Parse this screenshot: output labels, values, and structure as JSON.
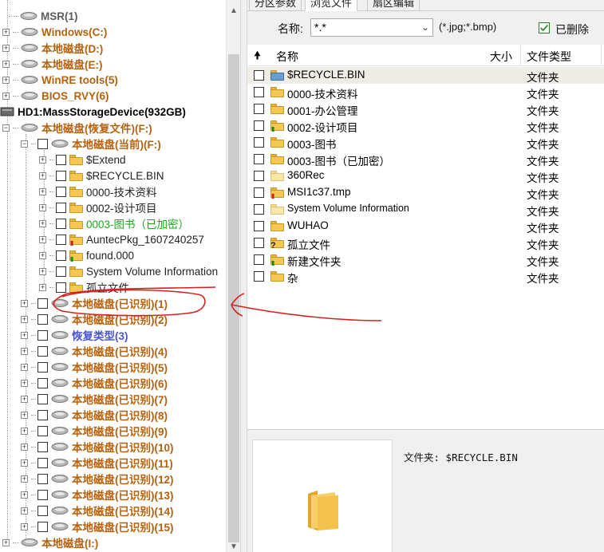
{
  "tabs": [
    "分区参数",
    "浏览文件",
    "扇区编辑"
  ],
  "filter": {
    "name_label": "名称:",
    "name_value": "*.*",
    "ext_hint": "(*.jpg;*.bmp)",
    "deleted_label": "已删除",
    "deleted_checked": true
  },
  "file_list": {
    "columns": [
      "名称",
      "大小",
      "文件类型"
    ],
    "rows": [
      {
        "name": "$RECYCLE.BIN",
        "type": "文件夹",
        "selected": true,
        "icon": "recycle-folder-icon"
      },
      {
        "name": "0000-技术资料",
        "type": "文件夹",
        "icon": "folder-icon"
      },
      {
        "name": "0001-办公管理",
        "type": "文件夹",
        "icon": "folder-icon"
      },
      {
        "name": "0002-设计项目",
        "type": "文件夹",
        "icon": "folder-icon"
      },
      {
        "name": "0003-图书",
        "type": "文件夹",
        "icon": "folder-icon"
      },
      {
        "name": "0003-图书（已加密）",
        "type": "文件夹",
        "icon": "folder-icon"
      },
      {
        "name": "360Rec",
        "type": "文件夹",
        "icon": "folder-icon"
      },
      {
        "name": "MSI1c37.tmp",
        "type": "文件夹",
        "icon": "deleted-folder-icon"
      },
      {
        "name": "System Volume Information",
        "type": "文件夹",
        "icon": "folder-icon"
      },
      {
        "name": "WUHAO",
        "type": "文件夹",
        "icon": "folder-icon"
      },
      {
        "name": "孤立文件",
        "type": "文件夹",
        "icon": "lost-folder-icon"
      },
      {
        "name": "新建文件夹",
        "type": "文件夹",
        "icon": "folder-icon"
      },
      {
        "name": "杂",
        "type": "文件夹",
        "icon": "folder-icon"
      }
    ]
  },
  "preview": {
    "info": "文件夹: $RECYCLE.BIN"
  },
  "tree": [
    {
      "label": "MSR(1)",
      "style": "gray"
    },
    {
      "label": "Windows(C:)",
      "style": "orange"
    },
    {
      "label": "本地磁盘(D:)",
      "style": "orange"
    },
    {
      "label": "本地磁盘(E:)",
      "style": "orange"
    },
    {
      "label": "WinRE tools(5)",
      "style": "orange"
    },
    {
      "label": "BIOS_RVY(6)",
      "style": "orange"
    },
    {
      "label": "HD1:MassStorageDevice(932GB)",
      "style": "black"
    },
    {
      "label": "本地磁盘(恢复文件)(F:)",
      "style": "orange"
    },
    {
      "label": "本地磁盘(当前)(F:)",
      "style": "orange"
    },
    {
      "label": "$Extend",
      "style": "normal"
    },
    {
      "label": "$RECYCLE.BIN",
      "style": "normal"
    },
    {
      "label": "0000-技术资料",
      "style": "normal"
    },
    {
      "label": "0002-设计项目",
      "style": "normal"
    },
    {
      "label": "0003-图书（已加密）",
      "style": "green"
    },
    {
      "label": "AuntecPkg_1607240257",
      "style": "normal"
    },
    {
      "label": "found.000",
      "style": "normal"
    },
    {
      "label": "System Volume Information",
      "style": "normal"
    },
    {
      "label": "孤立文件",
      "style": "normal"
    },
    {
      "label": "本地磁盘(已识别)(1)",
      "style": "orange"
    },
    {
      "label": "本地磁盘(已识别)(2)",
      "style": "orange"
    },
    {
      "label": "恢复类型(3)",
      "style": "blue"
    },
    {
      "label": "本地磁盘(已识别)(4)",
      "style": "orange"
    },
    {
      "label": "本地磁盘(已识别)(5)",
      "style": "orange"
    },
    {
      "label": "本地磁盘(已识别)(6)",
      "style": "orange"
    },
    {
      "label": "本地磁盘(已识别)(7)",
      "style": "orange"
    },
    {
      "label": "本地磁盘(已识别)(8)",
      "style": "orange"
    },
    {
      "label": "本地磁盘(已识别)(9)",
      "style": "orange"
    },
    {
      "label": "本地磁盘(已识别)(10)",
      "style": "orange"
    },
    {
      "label": "本地磁盘(已识别)(11)",
      "style": "orange"
    },
    {
      "label": "本地磁盘(已识别)(12)",
      "style": "orange"
    },
    {
      "label": "本地磁盘(已识别)(13)",
      "style": "orange"
    },
    {
      "label": "本地磁盘(已识别)(14)",
      "style": "orange"
    },
    {
      "label": "本地磁盘(已识别)(15)",
      "style": "orange"
    },
    {
      "label": "本地磁盘(I:)",
      "style": "orange"
    }
  ],
  "colors": {
    "orange": "#b5620f",
    "blue": "#4a55d6",
    "green": "#1aa51a",
    "annotation": "#d42020",
    "selected_row": "#f0ede6"
  }
}
